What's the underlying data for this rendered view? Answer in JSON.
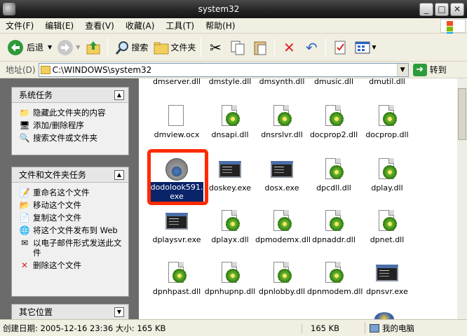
{
  "window": {
    "title": "system32"
  },
  "menu": [
    "文件(F)",
    "编辑(E)",
    "查看(V)",
    "收藏(A)",
    "工具(T)",
    "帮助(H)"
  ],
  "toolbar": {
    "back": "后退",
    "search": "搜索",
    "folders": "文件夹"
  },
  "address": {
    "label": "地址(D)",
    "path": "C:\\WINDOWS\\system32",
    "go": "转到"
  },
  "panels": {
    "system_tasks": {
      "title": "系统任务",
      "items": [
        "隐藏此文件夹的内容",
        "添加/删除程序",
        "搜索文件或文件夹"
      ]
    },
    "file_tasks": {
      "title": "文件和文件夹任务",
      "items": [
        "重命名这个文件",
        "移动这个文件",
        "复制这个文件",
        "将这个文件发布到 Web",
        "以电子邮件形式发送此文件",
        "删除这个文件"
      ]
    },
    "other_places": {
      "title": "其它位置"
    }
  },
  "files": {
    "row0": [
      "dmserver.dll",
      "dmstyle.dll",
      "dmsynth.dll",
      "dmusic.dll",
      "dmutil.dll"
    ],
    "row1": [
      "dmview.ocx",
      "dnsapi.dll",
      "dnsrslvr.dll",
      "docprop2.dll",
      "docprop.dll"
    ],
    "row2": [
      "dodolook591.exe",
      "doskey.exe",
      "dosx.exe",
      "dpcdll.dll",
      "dplay.dll"
    ],
    "row3": [
      "dplaysvr.exe",
      "dplayx.dll",
      "dpmodemx.dll",
      "dpnaddr.dll",
      "dpnet.dll"
    ],
    "row4": [
      "dpnhpast.dll",
      "dpnhupnp.dll",
      "dpnlobby.dll",
      "dpnmodem.dll",
      "dpnsvr.exe"
    ]
  },
  "status": {
    "info": "创建日期: 2005-12-16 23:36 大小: 165 KB",
    "size": "165 KB",
    "location": "我的电脑"
  }
}
